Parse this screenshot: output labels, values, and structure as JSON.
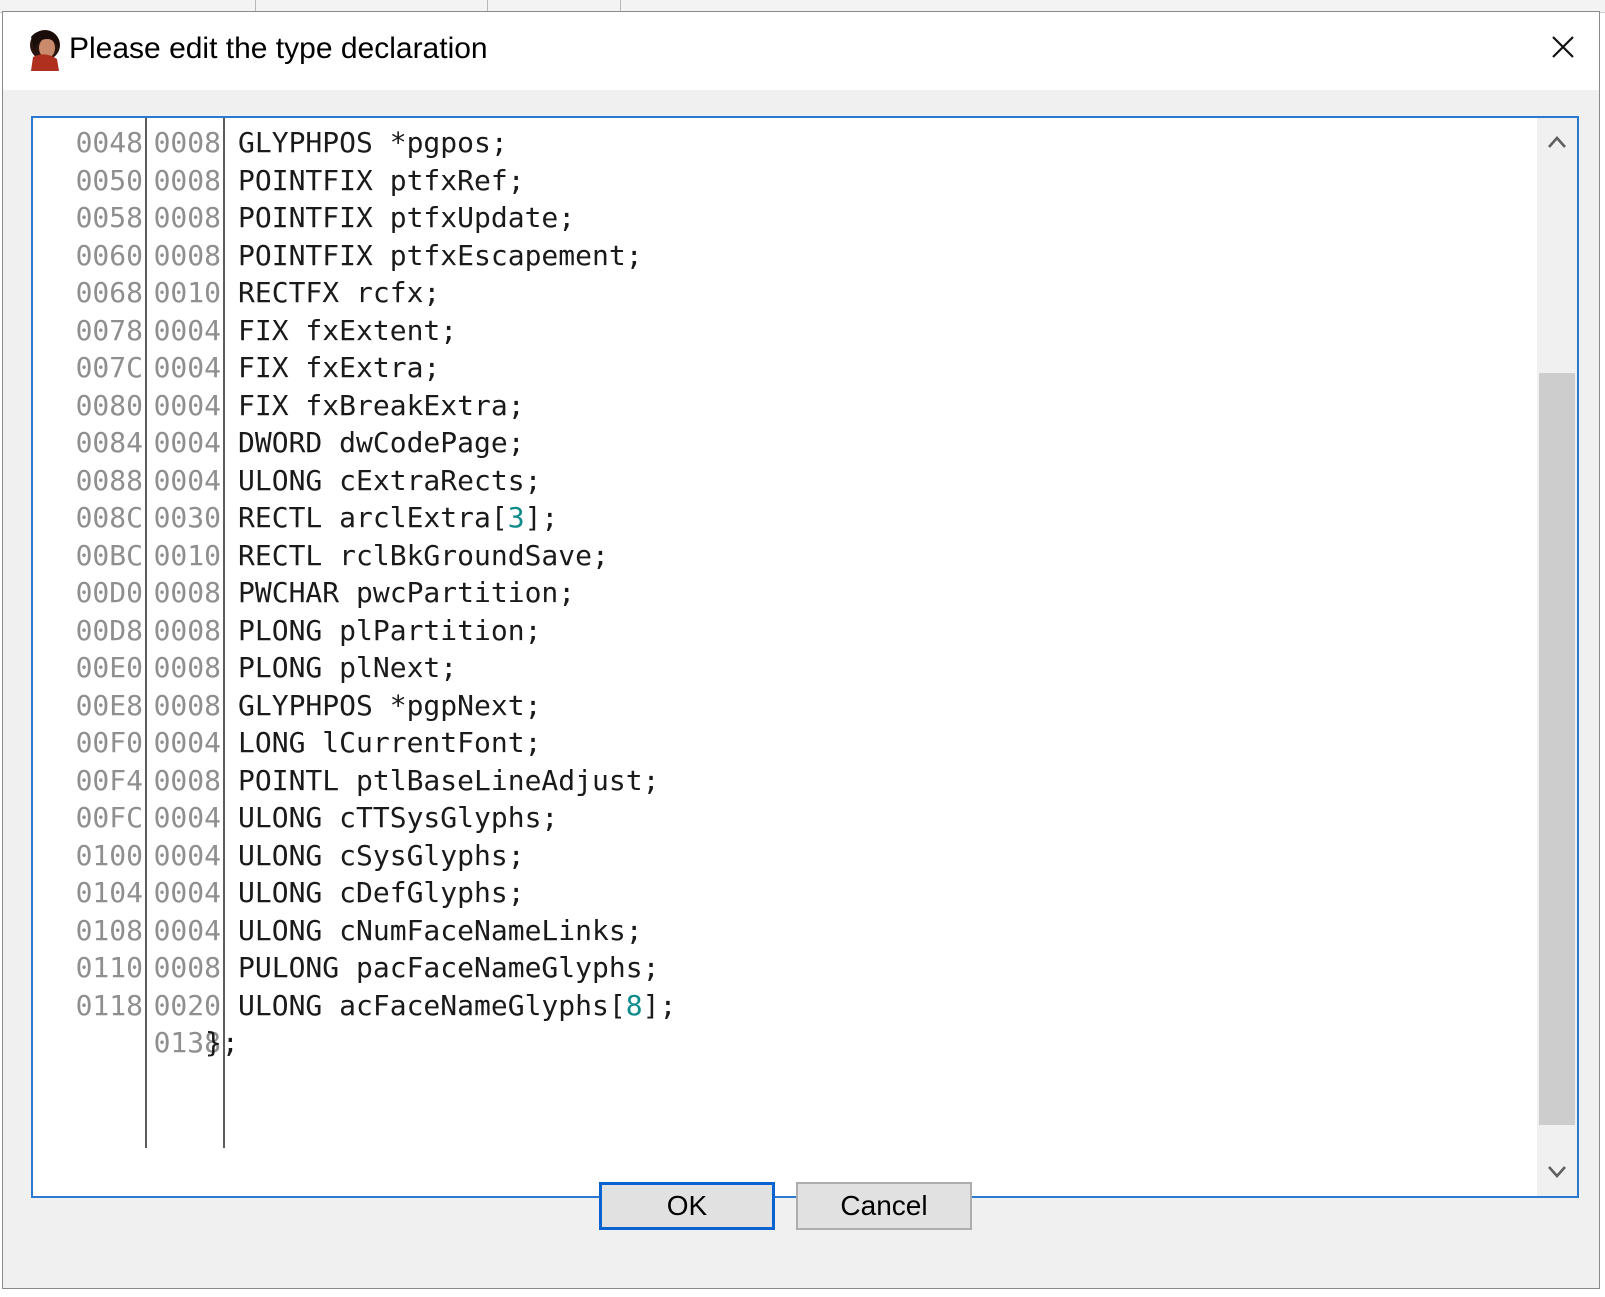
{
  "dialog": {
    "title": "Please edit the type declaration",
    "close_glyph": "✕",
    "icon": "avatar-icon"
  },
  "code_lines": [
    {
      "offset": "0048",
      "size": "0008",
      "text": "GLYPHPOS *pgpos;"
    },
    {
      "offset": "0050",
      "size": "0008",
      "text": "POINTFIX ptfxRef;"
    },
    {
      "offset": "0058",
      "size": "0008",
      "text": "POINTFIX ptfxUpdate;"
    },
    {
      "offset": "0060",
      "size": "0008",
      "text": "POINTFIX ptfxEscapement;"
    },
    {
      "offset": "0068",
      "size": "0010",
      "text": "RECTFX rcfx;"
    },
    {
      "offset": "0078",
      "size": "0004",
      "text": "FIX fxExtent;"
    },
    {
      "offset": "007C",
      "size": "0004",
      "text": "FIX fxExtra;"
    },
    {
      "offset": "0080",
      "size": "0004",
      "text": "FIX fxBreakExtra;"
    },
    {
      "offset": "0084",
      "size": "0004",
      "text": "DWORD dwCodePage;"
    },
    {
      "offset": "0088",
      "size": "0004",
      "text": "ULONG cExtraRects;"
    },
    {
      "offset": "008C",
      "size": "0030",
      "pre": "RECTL arclExtra[",
      "num": "3",
      "post": "];"
    },
    {
      "offset": "00BC",
      "size": "0010",
      "text": "RECTL rclBkGroundSave;"
    },
    {
      "offset": "00D0",
      "size": "0008",
      "text": "PWCHAR pwcPartition;"
    },
    {
      "offset": "00D8",
      "size": "0008",
      "text": "PLONG plPartition;"
    },
    {
      "offset": "00E0",
      "size": "0008",
      "text": "PLONG plNext;"
    },
    {
      "offset": "00E8",
      "size": "0008",
      "text": "GLYPHPOS *pgpNext;"
    },
    {
      "offset": "00F0",
      "size": "0004",
      "text": "LONG lCurrentFont;"
    },
    {
      "offset": "00F4",
      "size": "0008",
      "text": "POINTL ptlBaseLineAdjust;"
    },
    {
      "offset": "00FC",
      "size": "0004",
      "text": "ULONG cTTSysGlyphs;"
    },
    {
      "offset": "0100",
      "size": "0004",
      "text": "ULONG cSysGlyphs;"
    },
    {
      "offset": "0104",
      "size": "0004",
      "text": "ULONG cDefGlyphs;"
    },
    {
      "offset": "0108",
      "size": "0004",
      "text": "ULONG cNumFaceNameLinks;"
    },
    {
      "offset": "0110",
      "size": "0008",
      "text": "PULONG pacFaceNameGlyphs;"
    },
    {
      "offset": "0118",
      "size": "0020",
      "pre": "ULONG acFaceNameGlyphs[",
      "num": "8",
      "post": "];"
    },
    {
      "offset": "",
      "size": "0138",
      "text": "};",
      "closing": true
    }
  ],
  "buttons": {
    "ok_label": "OK",
    "cancel_label": "Cancel"
  },
  "scrollbar": {
    "up_icon": "chevron-up-icon",
    "down_icon": "chevron-down-icon",
    "position_fraction": 0.24
  },
  "colors": {
    "focus_border": "#2b79d0",
    "number_literal": "#0e8b8b",
    "gutter_text": "#8f8f8f"
  }
}
